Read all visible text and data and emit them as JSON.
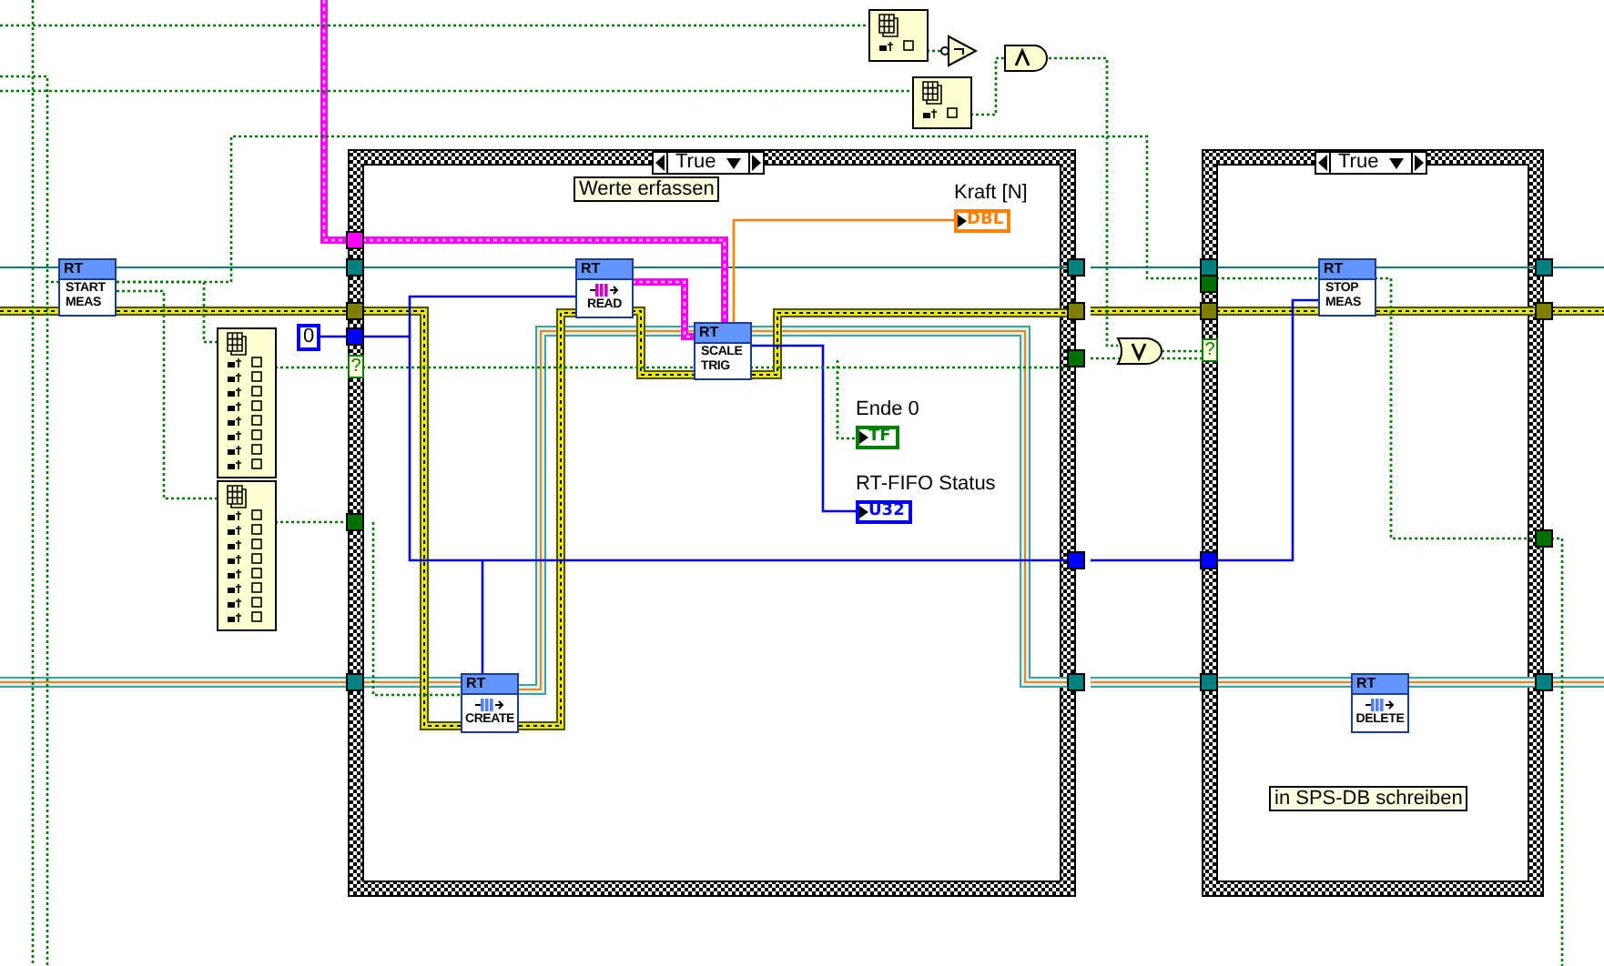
{
  "case_structures": [
    {
      "selector": "True",
      "label": "Werte erfassen"
    },
    {
      "selector": "True",
      "label": "in SPS-DB schreiben"
    }
  ],
  "subvis": [
    {
      "header": "RT",
      "label": "START MEAS",
      "kind": "text"
    },
    {
      "header": "RT",
      "label": "READ",
      "kind": "fifo",
      "color": "#cc00cc"
    },
    {
      "header": "RT",
      "label": "SCALE TRIG",
      "kind": "text"
    },
    {
      "header": "RT",
      "label": "CREATE",
      "kind": "fifo",
      "color": "#5080ff"
    },
    {
      "header": "RT",
      "label": "STOP MEAS",
      "kind": "text"
    },
    {
      "header": "RT",
      "label": "DELETE",
      "kind": "fifo",
      "color": "#5080ff"
    }
  ],
  "indicators": [
    {
      "label": "Kraft [N]",
      "type": "DBL"
    },
    {
      "label": "Ende 0",
      "type": "TF"
    },
    {
      "label": "RT-FIFO Status",
      "type": "U32"
    }
  ],
  "constant": "0",
  "selector_terminals": [
    "?",
    "?"
  ]
}
